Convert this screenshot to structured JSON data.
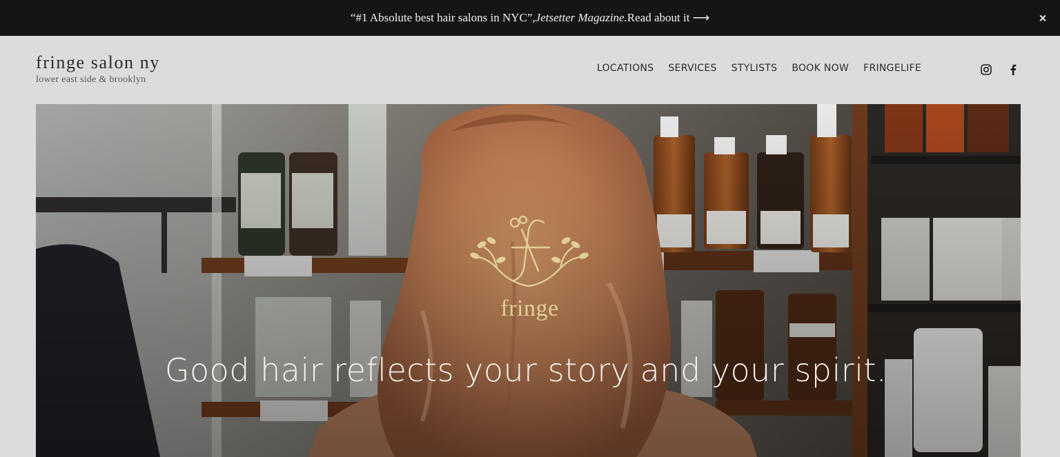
{
  "announcement": {
    "quote": "“#1 Absolute best hair salons in NYC”, ",
    "publication": "Jetsetter Magazine.",
    "link_text": " Read about it ⟶",
    "close_label": "×"
  },
  "brand": {
    "name": "fringe salon ny",
    "tagline": "lower east side & brooklyn"
  },
  "nav": {
    "items": [
      "LOCATIONS",
      "SERVICES",
      "STYLISTS",
      "BOOK NOW",
      "FRINGELIFE"
    ]
  },
  "social": {
    "icons": [
      "instagram-icon",
      "facebook-icon"
    ]
  },
  "hero": {
    "logo_text": "fringe",
    "headline": "Good hair reflects your story and your spirit."
  },
  "colors": {
    "announcement_bg": "#151515",
    "page_bg": "#dcdcdc",
    "logo_gold": "#e2cf95"
  }
}
